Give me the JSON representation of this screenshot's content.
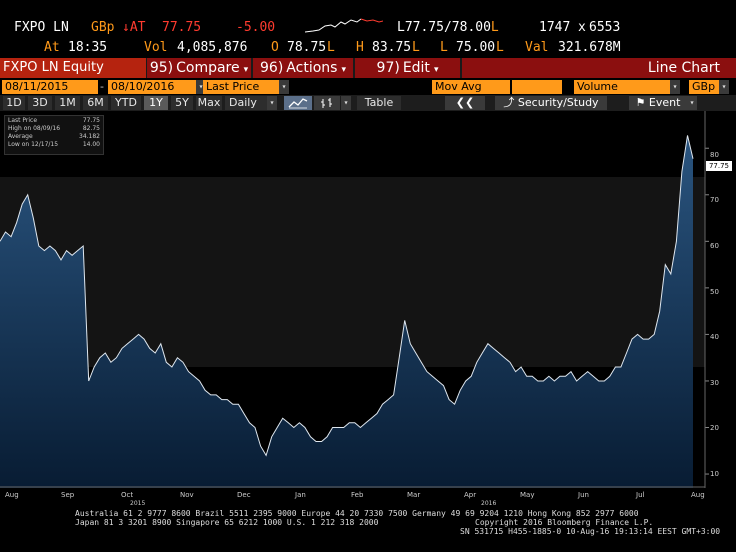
{
  "header": {
    "ticker": "FXPO LN",
    "currency": "GBp",
    "at_label": "↓AT",
    "last": "77.75",
    "change": "-5.00",
    "low_prefix": "L",
    "bid_ask": "77.75/78.00",
    "size_left": "1747",
    "size_x": "x",
    "size_right": "6553",
    "at_time_label": "At",
    "time": "18:35",
    "vol_label": "Vol",
    "vol": "4,085,876",
    "open_label": "O",
    "open": "78.75",
    "high_label": "H",
    "high": "83.75",
    "low_label": "L",
    "low": "75.00",
    "val_label": "Val",
    "val": "321.678M",
    "l_suffix": "L"
  },
  "toolbar": {
    "security": "FXPO LN Equity",
    "compare_num": "95)",
    "compare": "Compare",
    "actions_num": "96)",
    "actions": "Actions",
    "edit_num": "97)",
    "edit": "Edit",
    "chart_type": "Line Chart"
  },
  "row2": {
    "start_date": "08/11/2015",
    "end_date": "08/10/2016",
    "field": "Last Price",
    "mov_avg": "Mov Avg",
    "volume": "Volume",
    "ccy": "GBp"
  },
  "row3": {
    "periods": [
      "1D",
      "3D",
      "1M",
      "6M",
      "YTD",
      "1Y",
      "5Y",
      "Max"
    ],
    "selected": "1Y",
    "freq": "Daily",
    "table": "Table",
    "security_study": "Security/Study",
    "event": "Event"
  },
  "legend": {
    "rows": [
      {
        "label": "Last Price",
        "value": "77.75"
      },
      {
        "label": "High on 08/09/16",
        "value": "82.75"
      },
      {
        "label": "Average",
        "value": "34.182"
      },
      {
        "label": "Low on 12/17/15",
        "value": "14.00"
      }
    ]
  },
  "chart_data": {
    "type": "area",
    "title": "",
    "xlabel": "",
    "ylabel": "",
    "x_ticks": [
      "Aug",
      "Sep",
      "Oct",
      "Nov",
      "Dec",
      "Jan",
      "Feb",
      "Mar",
      "Apr",
      "May",
      "Jun",
      "Jul",
      "Aug"
    ],
    "year_labels": [
      "2015",
      "2016"
    ],
    "y_ticks": [
      10,
      20,
      30,
      40,
      50,
      60,
      70,
      80
    ],
    "ylim": [
      7,
      88
    ],
    "last_value_label": "77.75",
    "series": [
      {
        "values": [
          60,
          62,
          61,
          64,
          68,
          70,
          65,
          59,
          58,
          59,
          58,
          56,
          58,
          57,
          58,
          59,
          30,
          33,
          35,
          36,
          34,
          35,
          37,
          38,
          39,
          40,
          39,
          37,
          36,
          38,
          34,
          33,
          35,
          34,
          32,
          31,
          30,
          28,
          27,
          27,
          26,
          26,
          25,
          25,
          23,
          21,
          20,
          16,
          14,
          18,
          20,
          22,
          21,
          20,
          21,
          20,
          18,
          17,
          17,
          18,
          20,
          20,
          20,
          21,
          21,
          20,
          21,
          22,
          23,
          25,
          26,
          27,
          35,
          43,
          38,
          36,
          34,
          32,
          31,
          30,
          29,
          26,
          25,
          28,
          30,
          31,
          34,
          36,
          38,
          37,
          36,
          35,
          34,
          32,
          33,
          31,
          31,
          30,
          30,
          31,
          30,
          31,
          31,
          32,
          30,
          31,
          32,
          31,
          30,
          30,
          31,
          33,
          33,
          36,
          39,
          40,
          39,
          39,
          40,
          45,
          55,
          53,
          60,
          75,
          82.75,
          77.75
        ]
      }
    ],
    "colors": {
      "fill_top": "#2a5580",
      "fill_bottom": "#081c33",
      "line": "#dfe7ef"
    }
  },
  "footer": {
    "line1": "Australia 61 2 9777 8600 Brazil 5511 2395 9000 Europe 44 20 7330 7500 Germany 49 69 9204 1210 Hong Kong 852 2977 6000",
    "line2": "Japan 81 3 3201 8900       Singapore 65 6212 1000       U.S. 1 212 318 2000",
    "copyright": "Copyright 2016 Bloomberg Finance L.P.",
    "line3": "SN 531715 H455-1885-0 10-Aug-16 19:13:14 EEST GMT+3:00"
  }
}
